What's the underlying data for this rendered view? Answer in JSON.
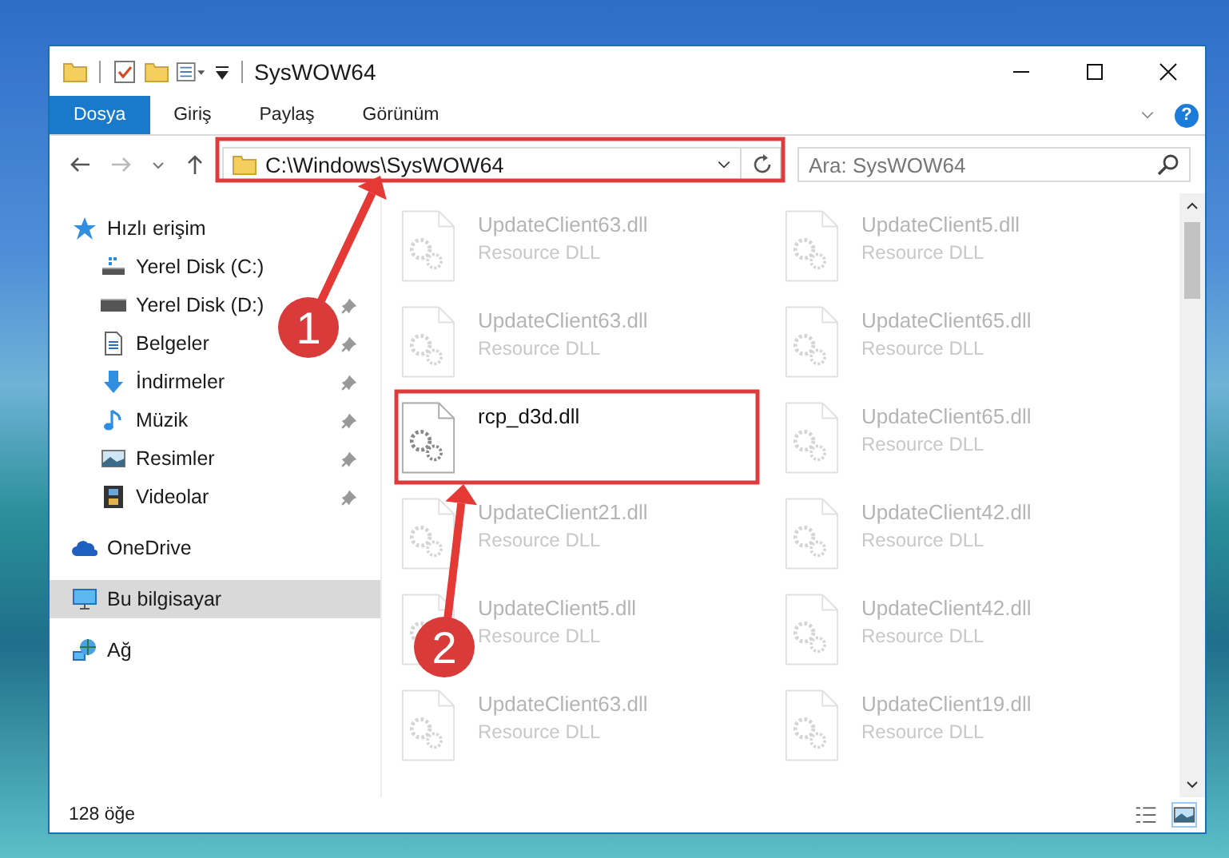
{
  "window": {
    "title": "SysWOW64"
  },
  "ribbon_tabs": [
    {
      "label": "Dosya",
      "selected": true
    },
    {
      "label": "Giriş",
      "selected": false
    },
    {
      "label": "Paylaş",
      "selected": false
    },
    {
      "label": "Görünüm",
      "selected": false
    }
  ],
  "address_bar": {
    "path": "C:\\Windows\\SysWOW64"
  },
  "search": {
    "placeholder": "Ara: SysWOW64"
  },
  "sidebar": {
    "items": [
      {
        "label": "Hızlı erişim",
        "kind": "star",
        "selected": false,
        "children": [
          {
            "label": "Yerel Disk (C:)",
            "kind": "drive-c",
            "pinned": false,
            "selected": false
          },
          {
            "label": "Yerel Disk (D:)",
            "kind": "drive",
            "pinned": true,
            "selected": false
          },
          {
            "label": "Belgeler",
            "kind": "docs",
            "pinned": true,
            "selected": false
          },
          {
            "label": "İndirmeler",
            "kind": "download",
            "pinned": true,
            "selected": false
          },
          {
            "label": "Müzik",
            "kind": "music",
            "pinned": true,
            "selected": false
          },
          {
            "label": "Resimler",
            "kind": "pictures",
            "pinned": true,
            "selected": false
          },
          {
            "label": "Videolar",
            "kind": "videos",
            "pinned": true,
            "selected": false
          }
        ]
      },
      {
        "label": "OneDrive",
        "kind": "cloud",
        "selected": false
      },
      {
        "label": "Bu bilgisayar",
        "kind": "computer",
        "selected": true
      },
      {
        "label": "Ağ",
        "kind": "network",
        "selected": false
      }
    ]
  },
  "files": [
    {
      "name": "UpdateClient63.dll",
      "type": "Resource DLL",
      "faded": true
    },
    {
      "name": "UpdateClient5.dll",
      "type": "Resource DLL",
      "faded": true
    },
    {
      "name": "UpdateClient63.dll",
      "type": "Resource DLL",
      "faded": true
    },
    {
      "name": "UpdateClient65.dll",
      "type": "Resource DLL",
      "faded": true
    },
    {
      "name": "rcp_d3d.dll",
      "faded": false
    },
    {
      "name": "UpdateClient65.dll",
      "type": "Resource DLL",
      "faded": true
    },
    {
      "name": "UpdateClient21.dll",
      "type": "Resource DLL",
      "faded": true
    },
    {
      "name": "UpdateClient42.dll",
      "type": "Resource DLL",
      "faded": true
    },
    {
      "name": "UpdateClient5.dll",
      "type": "Resource DLL",
      "faded": true
    },
    {
      "name": "UpdateClient42.dll",
      "type": "Resource DLL",
      "faded": true
    },
    {
      "name": "UpdateClient63.dll",
      "type": "Resource DLL",
      "faded": true
    },
    {
      "name": "UpdateClient19.dll",
      "type": "Resource DLL",
      "faded": true
    }
  ],
  "status_bar": {
    "item_count": "128 öğe"
  },
  "help_button": {
    "label": "?"
  },
  "annotations": [
    {
      "number": "1"
    },
    {
      "number": "2"
    }
  ]
}
